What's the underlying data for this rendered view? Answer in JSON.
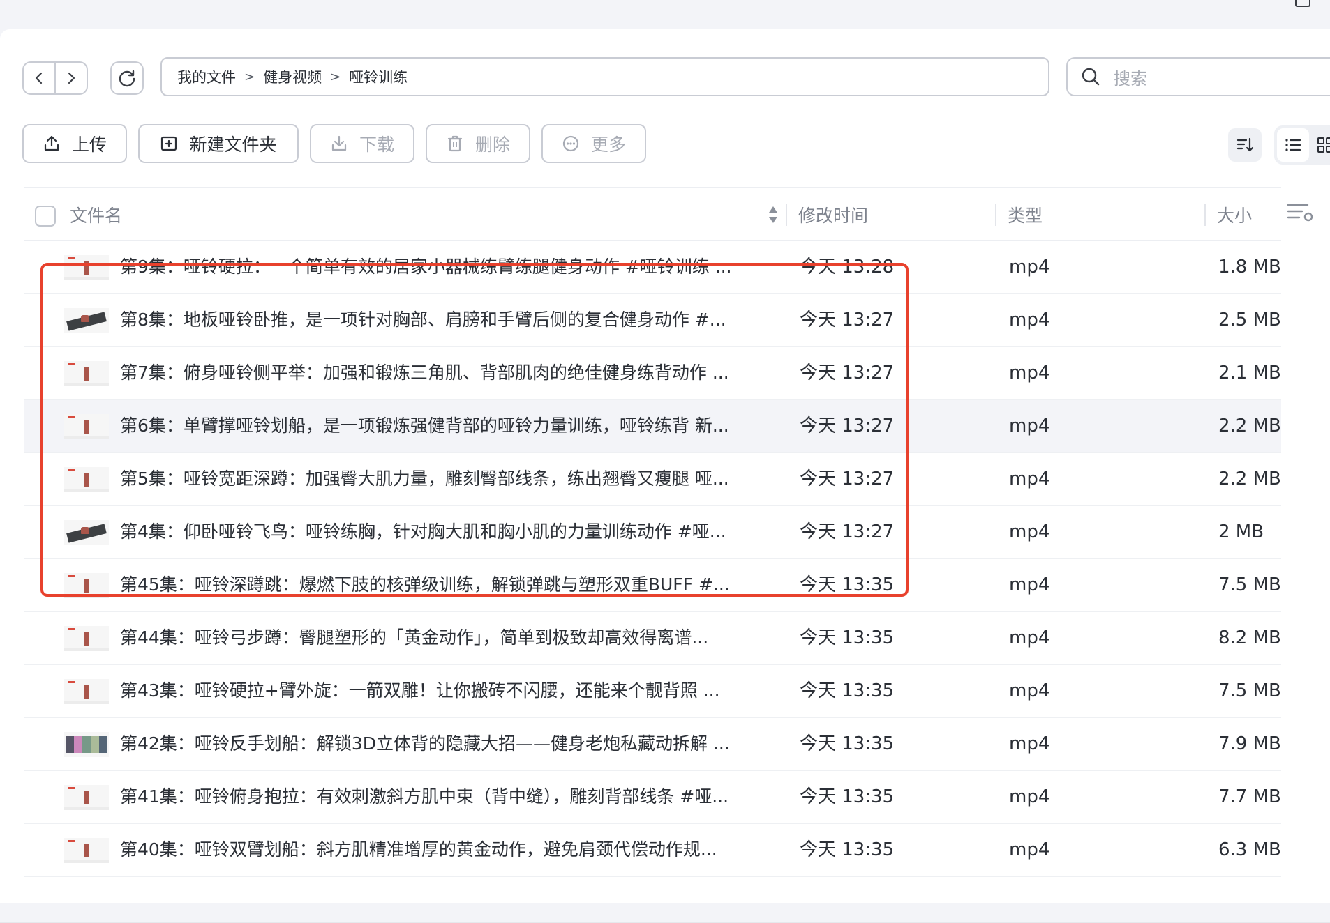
{
  "nav": {
    "breadcrumb": [
      "我的文件",
      "健身视频",
      "哑铃训练"
    ],
    "separator": ">"
  },
  "search": {
    "placeholder": "搜索"
  },
  "toolbar": {
    "upload": "上传",
    "new_folder": "新建文件夹",
    "download": "下载",
    "delete": "删除",
    "more": "更多"
  },
  "columns": {
    "name": "文件名",
    "modified": "修改时间",
    "type": "类型",
    "size": "大小"
  },
  "files": [
    {
      "name": "第9集：哑铃硬拉：一个简单有效的居家小器械练臂练腿健身动作 #哑铃训练 ...",
      "modified": "今天 13:28",
      "type": "mp4",
      "size": "1.8 MB",
      "thumb": "standing"
    },
    {
      "name": "第8集：地板哑铃卧推，是一项针对胸部、肩膀和手臂后侧的复合健身动作 #...",
      "modified": "今天 13:27",
      "type": "mp4",
      "size": "2.5 MB",
      "thumb": "mat"
    },
    {
      "name": "第7集：俯身哑铃侧平举：加强和锻炼三角肌、背部肌肉的绝佳健身练背动作 ...",
      "modified": "今天 13:27",
      "type": "mp4",
      "size": "2.1 MB",
      "thumb": "standing"
    },
    {
      "name": "第6集：单臂撑哑铃划船，是一项锻炼强健背部的哑铃力量训练，哑铃练背 新...",
      "modified": "今天 13:27",
      "type": "mp4",
      "size": "2.2 MB",
      "thumb": "standing"
    },
    {
      "name": "第5集：哑铃宽距深蹲：加强臀大肌力量，雕刻臀部线条，练出翘臀又瘦腿 哑...",
      "modified": "今天 13:27",
      "type": "mp4",
      "size": "2.2 MB",
      "thumb": "standing"
    },
    {
      "name": "第4集：仰卧哑铃飞鸟：哑铃练胸，针对胸大肌和胸小肌的力量训练动作 #哑...",
      "modified": "今天 13:27",
      "type": "mp4",
      "size": "2 MB",
      "thumb": "mat"
    },
    {
      "name": "第45集：哑铃深蹲跳：爆燃下肢的核弹级训练，解锁弹跳与塑形双重BUFF #...",
      "modified": "今天 13:35",
      "type": "mp4",
      "size": "7.5 MB",
      "thumb": "standing"
    },
    {
      "name": "第44集：哑铃弓步蹲：臀腿塑形的「黄金动作」，简单到极致却高效得离谱...",
      "modified": "今天 13:35",
      "type": "mp4",
      "size": "8.2 MB",
      "thumb": "standing"
    },
    {
      "name": "第43集：哑铃硬拉+臂外旋：一箭双雕！让你搬砖不闪腰，还能来个靓背照 ...",
      "modified": "今天 13:35",
      "type": "mp4",
      "size": "7.5 MB",
      "thumb": "standing"
    },
    {
      "name": "第42集：哑铃反手划船：解锁3D立体背的隐藏大招——健身老炮私藏动拆解 ...",
      "modified": "今天 13:35",
      "type": "mp4",
      "size": "7.9 MB",
      "thumb": "collage"
    },
    {
      "name": "第41集：哑铃俯身抱拉：有效刺激斜方肌中束（背中缝），雕刻背部线条 #哑...",
      "modified": "今天 13:35",
      "type": "mp4",
      "size": "7.7 MB",
      "thumb": "standing"
    },
    {
      "name": "第40集：哑铃双臂划船：斜方肌精准增厚的黄金动作，避免肩颈代偿动作规...",
      "modified": "今天 13:35",
      "type": "mp4",
      "size": "6.3 MB",
      "thumb": "standing"
    }
  ],
  "colors": {
    "highlight": "#e8412d",
    "border": "#c9ccd4",
    "muted_text": "#7e838e",
    "disabled_text": "#a7abb4"
  }
}
